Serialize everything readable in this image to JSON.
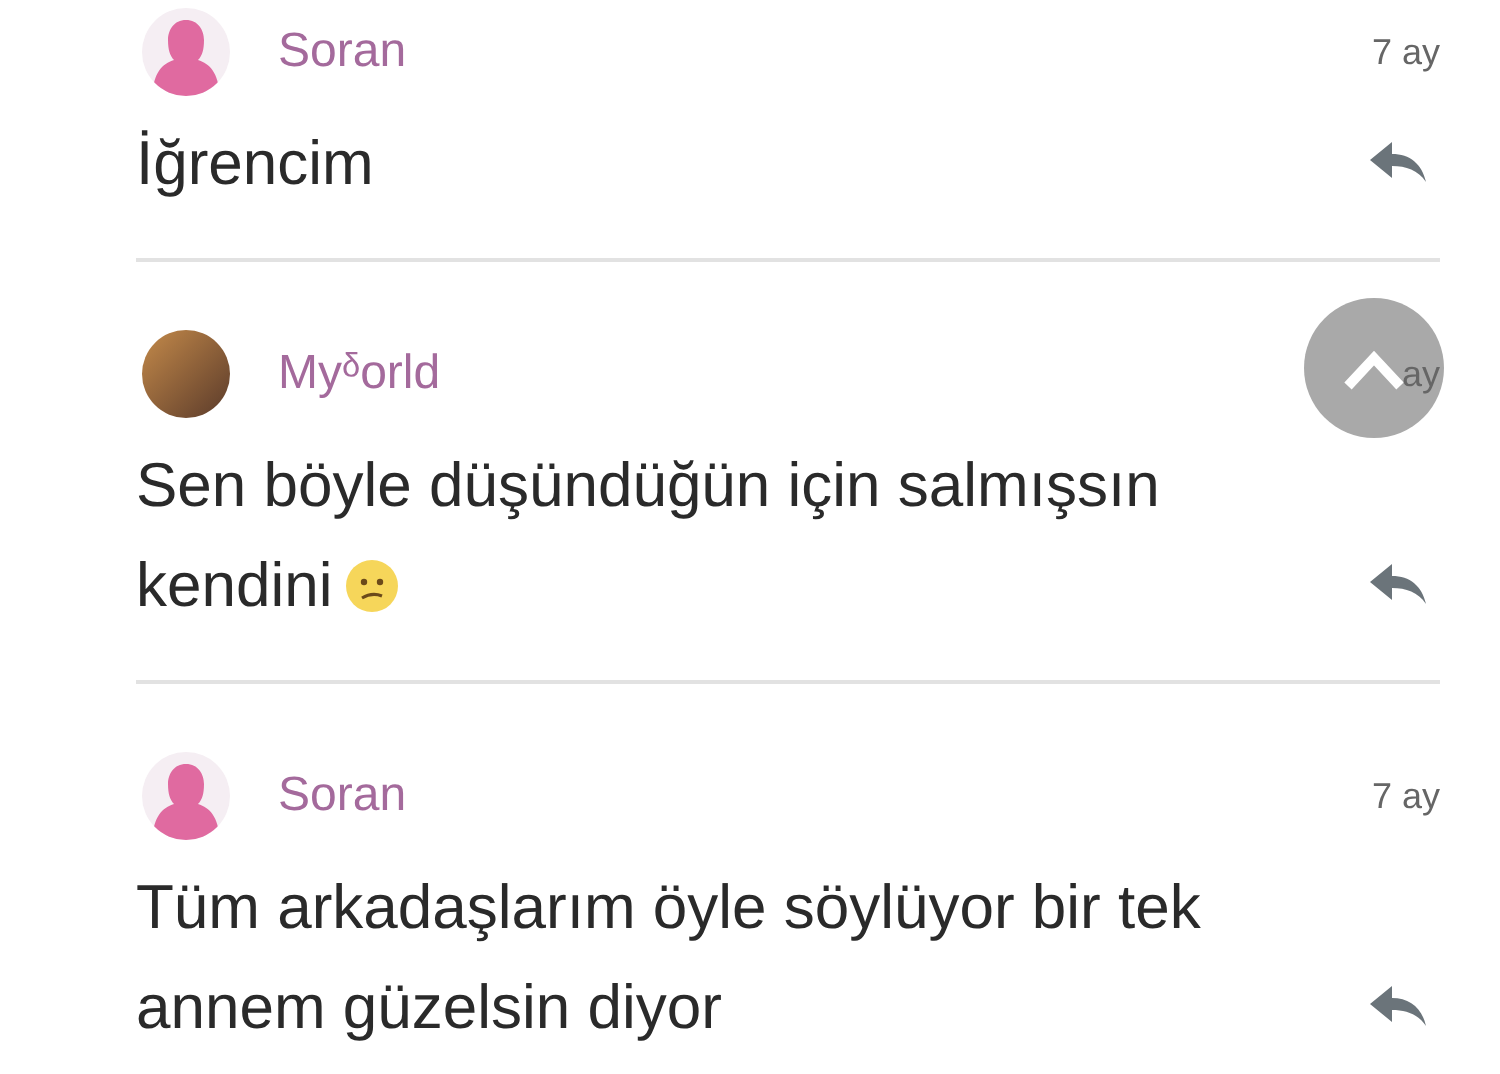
{
  "comments": [
    {
      "author": "Soran",
      "avatar": {
        "kind": "silhouette"
      },
      "time": "7 ay",
      "text": "İğrencim"
    },
    {
      "author": "Myᵟorld",
      "avatar": {
        "kind": "photo"
      },
      "time": "ay",
      "text": "Sen böyle düşündüğün için salmışsın kendini",
      "emoji": {
        "kind": "confused"
      }
    },
    {
      "author": "Soran",
      "avatar": {
        "kind": "silhouette"
      },
      "time": "7 ay",
      "text": "Tüm arkadaşlarım öyle söylüyor bir tek annem güzelsin diyor"
    }
  ],
  "scroll_top_button": {
    "shown": true
  }
}
